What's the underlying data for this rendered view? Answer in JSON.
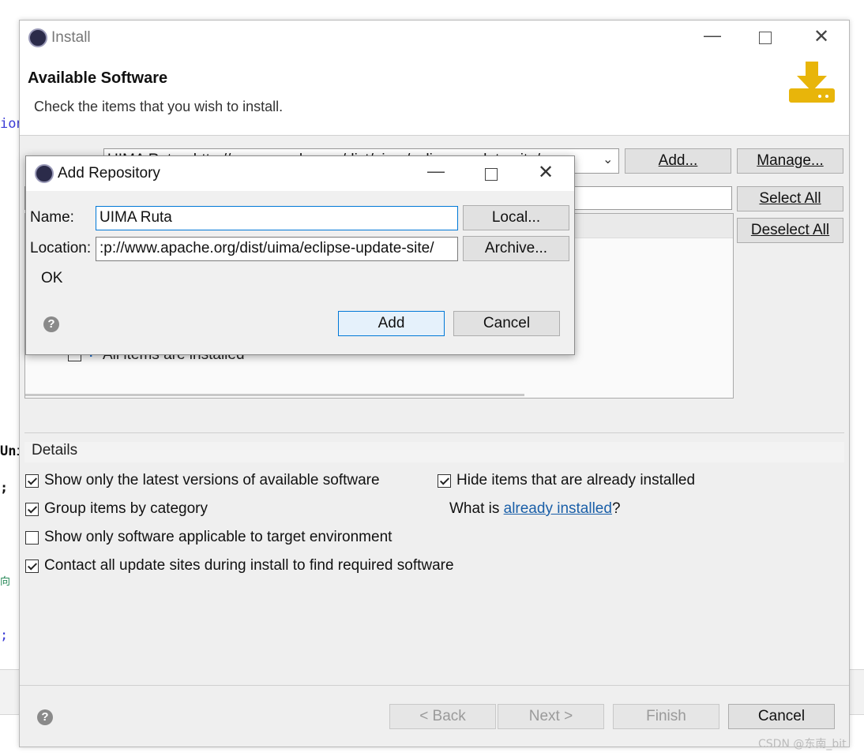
{
  "background_code": {
    "line1": "ion",
    "line2": "Uni",
    "line3": ";",
    "line4": "向",
    "line5": ";"
  },
  "window": {
    "title": "Install",
    "header_title": "Available Software",
    "header_subtitle": "Check the items that you wish to install.",
    "work_with_value": "UIMA Ruta - http://www.apache.org/dist/uima/eclipse-update-site/",
    "add_button": "Add...",
    "manage_button": "Manage...",
    "select_all_button": "Select All",
    "deselect_all_button": "Deselect All",
    "list_item": "All items are installed",
    "details_label": "Details",
    "options": {
      "latest_versions": "Show only the latest versions of available software",
      "hide_installed": "Hide items that are already installed",
      "group_by_category": "Group items by category",
      "what_is_prefix": "What is ",
      "already_installed_link": "already installed",
      "what_is_suffix": "?",
      "target_env": "Show only software applicable to target environment",
      "contact_sites": "Contact all update sites during install to find required software"
    },
    "back_button": "< Back",
    "next_button": "Next >",
    "finish_button": "Finish",
    "cancel_button": "Cancel"
  },
  "dialog": {
    "title": "Add Repository",
    "name_label": "Name:",
    "name_value": "UIMA Ruta",
    "location_label": "Location:",
    "location_value": ":p://www.apache.org/dist/uima/eclipse-update-site/",
    "local_button": "Local...",
    "archive_button": "Archive...",
    "status": "OK",
    "add_button": "Add",
    "cancel_button": "Cancel"
  },
  "watermark": "CSDN @东南_bit",
  "colors": {
    "accent": "#0078d7",
    "link": "#1a5fa8",
    "install_icon": "#e8b50a"
  }
}
